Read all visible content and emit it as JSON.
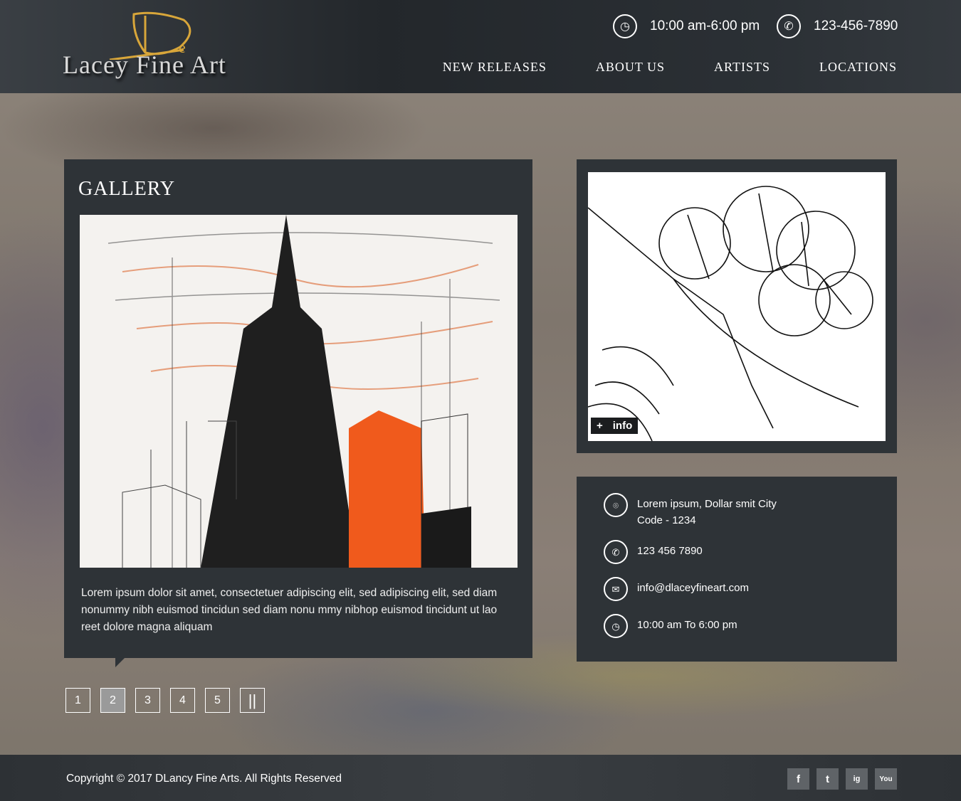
{
  "header": {
    "logo_text": "Lacey Fine Art",
    "logo_mark": "De",
    "hours": "10:00 am-6:00 pm",
    "phone": "123-456-7890",
    "nav": [
      "NEW RELEASES",
      "ABOUT US",
      "ARTISTS",
      "LOCATIONS"
    ]
  },
  "gallery": {
    "title": "GALLERY",
    "description": "Lorem ipsum dolor sit amet, consectetuer adipiscing elit, sed adipiscing elit, sed diam  nonummy nibh euismod tincidun sed diam nonu mmy nibhop euismod tincidunt ut lao reet dolore magna aliquam",
    "pages": [
      "1",
      "2",
      "3",
      "4",
      "5"
    ],
    "active_page": "2",
    "pause_label": "||"
  },
  "side_image": {
    "info_plus": "+",
    "info_label": "info"
  },
  "contact": {
    "address_line1": "Lorem ipsum, Dollar smit City",
    "address_line2": "Code - 1234",
    "phone": "123 456 7890",
    "email": "info@dlaceyfineart.com",
    "hours": "10:00 am To 6:00 pm"
  },
  "footer": {
    "copyright": "Copyright ©  2017  DLancy Fine Arts. All Rights  Reserved",
    "social": [
      "f",
      "t",
      "ig",
      "You"
    ]
  }
}
